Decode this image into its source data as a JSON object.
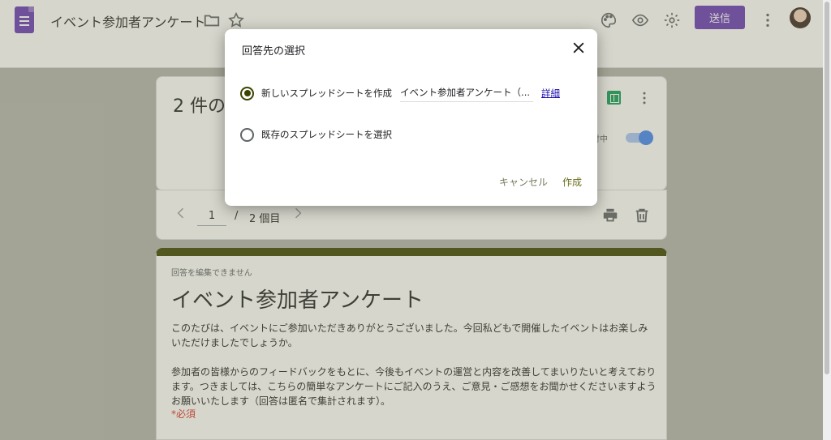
{
  "header": {
    "title": "イベント参加者アンケート",
    "send_label": "送信",
    "icons": [
      "forms-logo",
      "folder-icon",
      "star-icon",
      "palette-icon",
      "eye-icon",
      "gear-icon",
      "more-vert-icon"
    ]
  },
  "responses": {
    "count_label": "2 件の",
    "accepting_label": "付中",
    "page_current": "1",
    "page_separator": "/",
    "page_total": "2 個目"
  },
  "form": {
    "not_editable": "回答を編集できません",
    "title": "イベント参加者アンケート",
    "description_1": "このたびは、イベントにご参加いただきありがとうございました。今回私どもで開催したイベントはお楽しみいただけましたでしょうか。",
    "description_2": "参加者の皆様からのフィードバックをもとに、今後もイベントの運営と内容を改善してまいりたいと考えております。つきましては、こちらの簡単なアンケートにご記入のうえ、ご意見・ご感想をお聞かせくださいますようお願いいたします（回答は匿名で集計されます）。",
    "required_label": "*必須",
    "accent_color": "#3c4500"
  },
  "dialog": {
    "title": "回答先の選択",
    "option_new": "新しいスプレッドシートを作成",
    "new_sheet_name": "イベント参加者アンケート（...",
    "details_link": "詳細",
    "option_existing": "既存のスプレッドシートを選択",
    "selected_option": "新しいスプレッドシートを作成",
    "cancel_label": "キャンセル",
    "create_label": "作成"
  }
}
